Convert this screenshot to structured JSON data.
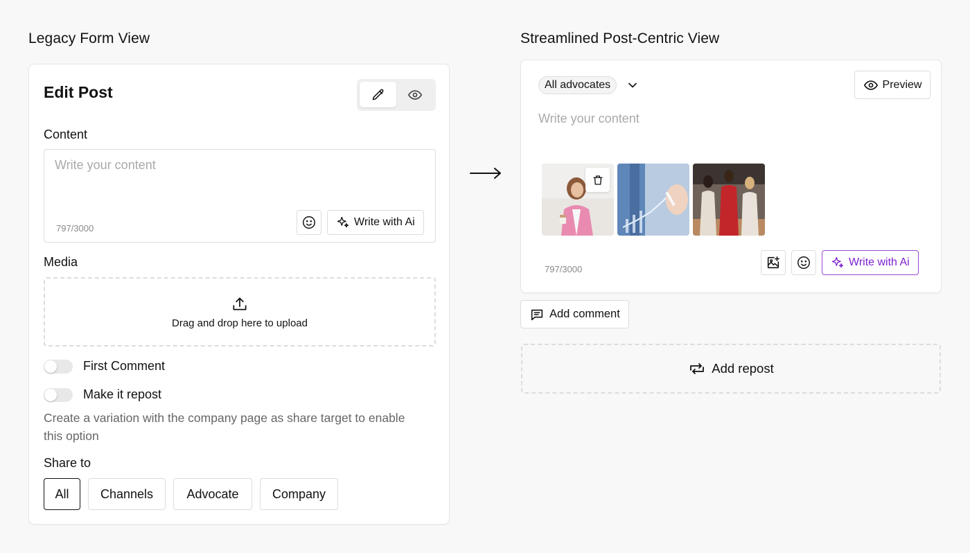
{
  "legacy": {
    "section_title": "Legacy Form View",
    "card_title": "Edit Post",
    "content_label": "Content",
    "content_placeholder": "Write your content",
    "counter": "797/3000",
    "write_ai_label": "Write with Ai",
    "media_label": "Media",
    "dropzone_text": "Drag and drop here to upload",
    "first_comment_label": "First Comment",
    "first_comment_enabled": false,
    "repost_label": "Make it repost",
    "repost_enabled": false,
    "repost_help": "Create a variation with the company page as share target to enable this option",
    "share_label": "Share to",
    "share_options": [
      "All",
      "Channels",
      "Advocate",
      "Company"
    ],
    "share_selected": "All"
  },
  "streamlined": {
    "section_title": "Streamlined Post-Centric View",
    "audience": "All advocates",
    "preview_label": "Preview",
    "content_placeholder": "Write your content",
    "counter": "797/3000",
    "write_ai_label": "Write with Ai",
    "add_comment_label": "Add comment",
    "add_repost_label": "Add repost",
    "media_thumbnails": [
      "woman-with-coffee-photo",
      "hand-drawing-chart-photo",
      "women-walking-office-photo"
    ]
  },
  "colors": {
    "background": "#f8f8f8",
    "accent_purple": "#9b45d6",
    "accent_purple_text": "#7e22ce"
  },
  "icons": [
    "pencil-icon",
    "eye-icon",
    "smiley-icon",
    "sparkle-icon",
    "upload-icon",
    "arrow-right-icon",
    "chevron-down-icon",
    "trash-icon",
    "image-add-icon",
    "comment-icon",
    "repost-icon"
  ]
}
